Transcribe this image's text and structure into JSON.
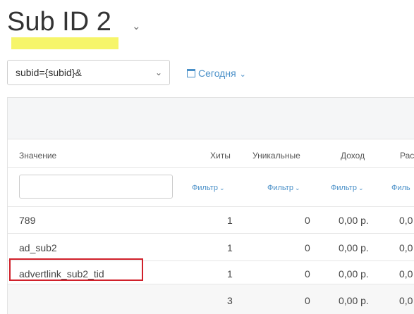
{
  "header": {
    "title": "Sub ID 2",
    "caret_icon": "chevron-down-icon",
    "highlight_color": "#f6f56a"
  },
  "toolbar": {
    "select_value": "subid={subid}&",
    "date_label": "Сегодня",
    "date_icon": "calendar-icon",
    "accent_color": "#4a90c8"
  },
  "table": {
    "columns": [
      "Значение",
      "Хиты",
      "Уникальные",
      "Доход",
      "Рас"
    ],
    "filter_label": "Фильтр",
    "filter_label_cut": "Филь",
    "rows": [
      {
        "value": "789",
        "hits": "1",
        "unique": "0",
        "income": "0,00 р.",
        "extra": "0,0"
      },
      {
        "value": "ad_sub2",
        "hits": "1",
        "unique": "0",
        "income": "0,00 р.",
        "extra": "0,0"
      },
      {
        "value": "advertlink_sub2_tid",
        "hits": "1",
        "unique": "0",
        "income": "0,00 р.",
        "extra": "0,0"
      }
    ],
    "total": {
      "hits": "3",
      "unique": "0",
      "income": "0,00 р.",
      "extra": "0,0"
    },
    "annotation_color": "#d0202a"
  }
}
